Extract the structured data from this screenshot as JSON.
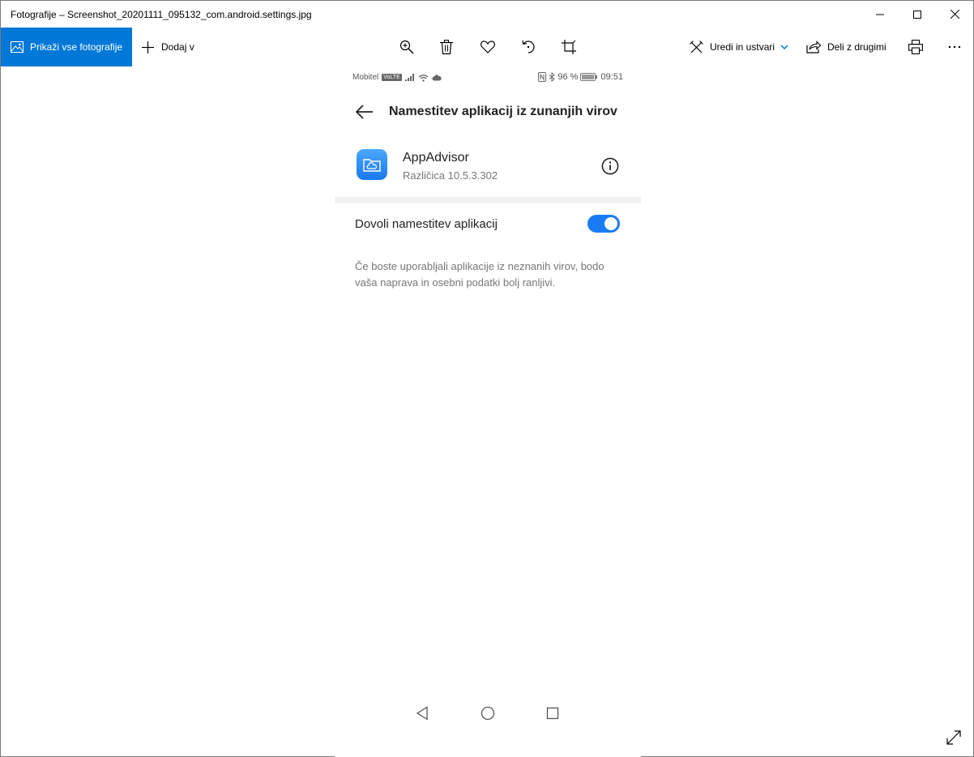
{
  "window": {
    "title": "Fotografije – Screenshot_20201111_095132_com.android.settings.jpg"
  },
  "toolbar": {
    "show_all_label": "Prikaži vse fotografije",
    "add_label": "Dodaj v",
    "edit_label": "Uredi in ustvari",
    "share_label": "Deli z drugimi",
    "accent_color": "#0078d7"
  },
  "phone": {
    "status": {
      "carrier": "Mobitel",
      "network_badge": "VoLTE",
      "battery": "96 %",
      "time": "09:51"
    },
    "header": {
      "title": "Namestitev aplikacij iz zunanjih virov"
    },
    "app": {
      "name": "AppAdvisor",
      "version": "Različica 10.5.3.302"
    },
    "setting": {
      "label": "Dovoli namestitev aplikacij",
      "enabled": true,
      "toggle_color": "#1a7cf5"
    },
    "warning": "Če boste uporabljali aplikacije iz neznanih virov, bodo vaša naprava in osebni podatki bolj ranljivi."
  }
}
